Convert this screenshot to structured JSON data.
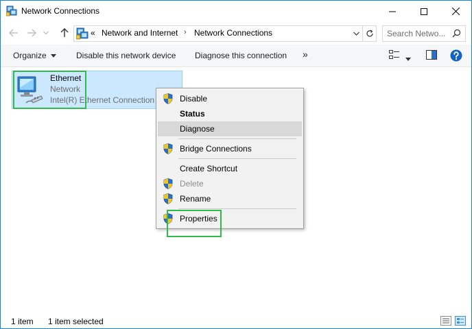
{
  "window": {
    "title": "Network Connections"
  },
  "address": {
    "overflow": "«",
    "crumbs": [
      "Network and Internet",
      "Network Connections"
    ],
    "separator": "›"
  },
  "search": {
    "placeholder": "Search Netwo..."
  },
  "commands": {
    "organize": "Organize",
    "disable_device": "Disable this network device",
    "diagnose_connection": "Diagnose this connection",
    "more": "»"
  },
  "item": {
    "name": "Ethernet",
    "status": "Network",
    "adapter": "Intel(R) Ethernet Connection"
  },
  "context_menu": {
    "items": [
      {
        "label": "Disable",
        "shield": true,
        "bold": false,
        "disabled": false
      },
      {
        "label": "Status",
        "shield": false,
        "bold": true,
        "disabled": false
      },
      {
        "label": "Diagnose",
        "shield": false,
        "bold": false,
        "disabled": false,
        "hovered": true
      },
      {
        "label": "Bridge Connections",
        "shield": true,
        "bold": false,
        "disabled": false
      },
      {
        "label": "Create Shortcut",
        "shield": false,
        "bold": false,
        "disabled": false
      },
      {
        "label": "Delete",
        "shield": true,
        "bold": false,
        "disabled": true
      },
      {
        "label": "Rename",
        "shield": true,
        "bold": false,
        "disabled": false
      },
      {
        "label": "Properties",
        "shield": true,
        "bold": false,
        "disabled": false
      }
    ]
  },
  "status": {
    "count": "1 item",
    "selected": "1 item selected"
  },
  "colors": {
    "accent": "#1883d7",
    "selection": "#cce8ff",
    "highlight_box": "#2dbb4a",
    "help": "#1565c0"
  }
}
